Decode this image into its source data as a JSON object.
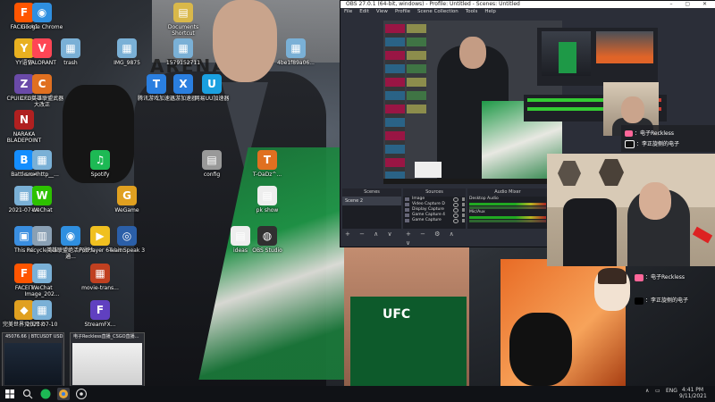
{
  "desktop_icons": [
    {
      "label": "FACEIT AC",
      "color": "#ff5500",
      "glyph": "F"
    },
    {
      "label": "Google Chrome",
      "color": "#2f8fe0",
      "glyph": "◉"
    },
    {
      "label": "Documents Shortcut",
      "color": "#d9b84a",
      "glyph": "▤"
    },
    {
      "label": "YY语音",
      "color": "#e8b020",
      "glyph": "Y"
    },
    {
      "label": "VALORANT",
      "color": "#ff4655",
      "glyph": "V"
    },
    {
      "label": "trash",
      "color": "#7ab0d6",
      "glyph": "▦"
    },
    {
      "label": "IMG_9875",
      "color": "#7ab0d6",
      "glyph": "▦"
    },
    {
      "label": "1579152711",
      "color": "#7ab0d6",
      "glyph": "▦"
    },
    {
      "label": "4be1f89a06...",
      "color": "#7ab0d6",
      "glyph": "▦"
    },
    {
      "label": "CPUID CPU-Z",
      "color": "#6a4aa8",
      "glyph": "Z"
    },
    {
      "label": "CFG英雄联盟武器大改正",
      "color": "#e07020",
      "glyph": "C"
    },
    {
      "label": "腾讯游戏加速器",
      "color": "#2a7fe0",
      "glyph": "T"
    },
    {
      "label": "迅游加速器",
      "color": "#2a7fe0",
      "glyph": "X"
    },
    {
      "label": "网易UU加速器",
      "color": "#1aa0e0",
      "glyph": "U"
    },
    {
      "label": "NARAKA BLADEPOINT",
      "color": "#b02020",
      "glyph": "N"
    },
    {
      "label": "Battle.net",
      "color": "#148eff",
      "glyph": "B"
    },
    {
      "label": "src=http__...",
      "color": "#7ab0d6",
      "glyph": "▦"
    },
    {
      "label": "Spotify",
      "color": "#1db954",
      "glyph": "♫"
    },
    {
      "label": "config",
      "color": "#999999",
      "glyph": "▤"
    },
    {
      "label": "T-OaDz^...",
      "color": "#e07020",
      "glyph": "T"
    },
    {
      "label": "2021-07-10",
      "color": "#7ab0d6",
      "glyph": "▦"
    },
    {
      "label": "WeChat",
      "color": "#2dc100",
      "glyph": "W"
    },
    {
      "label": "WeGame",
      "color": "#e0a020",
      "glyph": "G"
    },
    {
      "label": "pk show",
      "color": "#eeeeee",
      "glyph": "▤"
    },
    {
      "label": "This PC",
      "color": "#3a8ee0",
      "glyph": "▣"
    },
    {
      "label": "Recycle Bin",
      "color": "#8aa0b4",
      "glyph": "▥"
    },
    {
      "label": "英雄联盟绝活闪影大通...",
      "color": "#2f8fe0",
      "glyph": "◉"
    },
    {
      "label": "PotPlayer 64 bit",
      "color": "#f0c020",
      "glyph": "▶"
    },
    {
      "label": "TeamSpeak 3",
      "color": "#2b5fa8",
      "glyph": "◎"
    },
    {
      "label": "ideas",
      "color": "#eeeeee",
      "glyph": "▤"
    },
    {
      "label": "OBS Studio",
      "color": "#303030",
      "glyph": "◍"
    },
    {
      "label": "FACEIT",
      "color": "#ff5500",
      "glyph": "F"
    },
    {
      "label": "WeChat Image_202...",
      "color": "#7ab0d6",
      "glyph": "▦"
    },
    {
      "label": "movie-trans...",
      "color": "#c04020",
      "glyph": "▦"
    },
    {
      "label": "完美世界竞技平台",
      "color": "#e0a020",
      "glyph": "◆"
    },
    {
      "label": "2021-07-10",
      "color": "#7ab0d6",
      "glyph": "▦"
    },
    {
      "label": "StreamFX...",
      "color": "#6040c0",
      "glyph": "F"
    }
  ],
  "obs": {
    "title": "OBS 27.0.1 (64-bit, windows) - Profile: Untitled - Scenes: Untitled",
    "menu": [
      "File",
      "Edit",
      "View",
      "Profile",
      "Scene Collection",
      "Tools",
      "Help"
    ],
    "docks": {
      "scenes": {
        "title": "Scenes",
        "items": [
          "Scene 2"
        ]
      },
      "sources": {
        "title": "Sources",
        "items": [
          "Image",
          "Video Capture D",
          "Display Capture",
          "Game Capture 4",
          "Game Capture"
        ]
      },
      "mixer": {
        "title": "Audio Mixer",
        "channels": [
          "Desktop Audio",
          "Mic/Aux"
        ]
      }
    },
    "tools": "+ − ∧ ∨"
  },
  "social": {
    "bilibili": "：电子Reckless",
    "douyin": "：李正旋侧的电子"
  },
  "handles": {
    "red": "：电子Reckless",
    "tiktok": "：李正旋侧的电子"
  },
  "taskbar_windows": [
    {
      "title": "45076.66 | BTCUSDT USD..."
    },
    {
      "title": "电子Reckless直播_CSGO直播..."
    }
  ],
  "taskbar": {
    "lang": "ENG",
    "time": "4:41 PM",
    "date": "9/11/2021"
  }
}
